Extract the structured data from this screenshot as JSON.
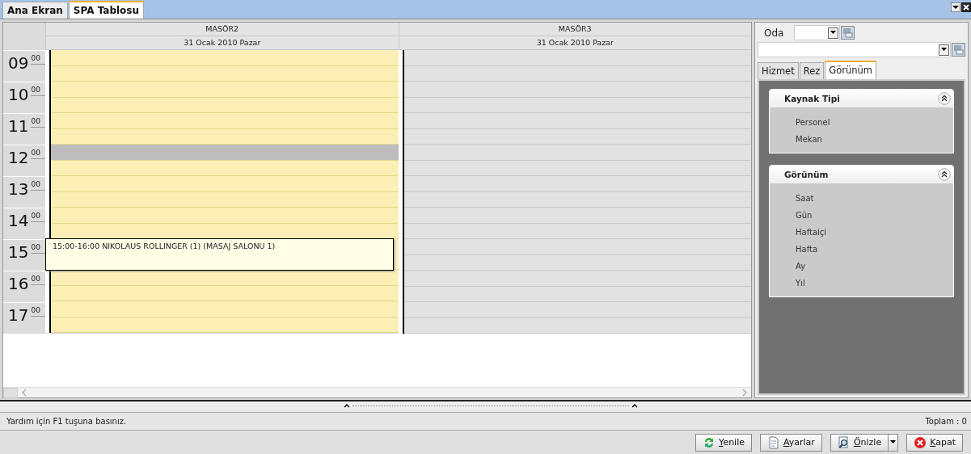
{
  "tabs": [
    {
      "label": "Ana Ekran",
      "selected": false
    },
    {
      "label": "SPA Tablosu",
      "selected": true
    }
  ],
  "calendar": {
    "hours": [
      {
        "hour": "09",
        "minutes": "00"
      },
      {
        "hour": "10",
        "minutes": "00"
      },
      {
        "hour": "11",
        "minutes": "00"
      },
      {
        "hour": "12",
        "minutes": "00"
      },
      {
        "hour": "13",
        "minutes": "00"
      },
      {
        "hour": "14",
        "minutes": "00"
      },
      {
        "hour": "15",
        "minutes": "00"
      },
      {
        "hour": "16",
        "minutes": "00"
      },
      {
        "hour": "17",
        "minutes": "00"
      }
    ],
    "columns": [
      {
        "resource": "MASÖR2",
        "date": "31 Ocak 2010 Pazar",
        "kind": "available",
        "slots": [
          {
            "blocked": false
          },
          {
            "blocked": false
          },
          {
            "blocked": false
          },
          {
            "blocked": false
          },
          {
            "blocked": false
          },
          {
            "blocked": false
          },
          {
            "blocked": true
          },
          {
            "blocked": false
          },
          {
            "blocked": false
          },
          {
            "blocked": false
          },
          {
            "blocked": false
          },
          {
            "blocked": false
          },
          {
            "kind": "appointment",
            "text": "15:00-16:00 NIKOLAUS ROLLINGER (1) (MASAJ SALONU 1)"
          },
          {
            "blocked": false
          },
          {
            "blocked": false
          },
          {
            "blocked": false
          },
          {
            "blocked": false
          }
        ]
      },
      {
        "resource": "MASÖR3",
        "date": "31 Ocak 2010 Pazar",
        "kind": "unavailable",
        "slots": [
          {
            "blocked": false
          },
          {
            "blocked": false
          },
          {
            "blocked": false
          },
          {
            "blocked": false
          },
          {
            "blocked": false
          },
          {
            "blocked": false
          },
          {
            "blocked": false
          },
          {
            "blocked": false
          },
          {
            "blocked": false
          },
          {
            "blocked": false
          },
          {
            "blocked": false
          },
          {
            "blocked": false
          },
          {
            "blocked": false
          },
          {
            "blocked": false
          },
          {
            "blocked": false
          },
          {
            "blocked": false
          },
          {
            "blocked": false
          },
          {
            "blocked": false
          }
        ]
      }
    ]
  },
  "side_panel": {
    "room_label": "Oda",
    "tabs": [
      {
        "label": "Hizmet",
        "selected": false
      },
      {
        "label": "Rez",
        "selected": false
      },
      {
        "label": "Görünüm",
        "selected": true
      }
    ],
    "groups": [
      {
        "title": "Kaynak Tipi",
        "expanded": true,
        "items": [
          "Personel",
          "Mekan"
        ]
      },
      {
        "title": "Görünüm",
        "expanded": true,
        "items": [
          "Saat",
          "Gün",
          "Haftaiçi",
          "Hafta",
          "Ay",
          "Yıl"
        ]
      }
    ]
  },
  "status_bar": {
    "help": "Yardım için F1 tuşuna basınız.",
    "total": "Toplam : 0"
  },
  "buttons": [
    {
      "label": "Yenile",
      "kind": "refresh"
    },
    {
      "label": "Ayarlar",
      "kind": "settings"
    },
    {
      "label": "Önizle",
      "kind": "preview"
    },
    {
      "label": "Kapat",
      "kind": "close"
    }
  ]
}
